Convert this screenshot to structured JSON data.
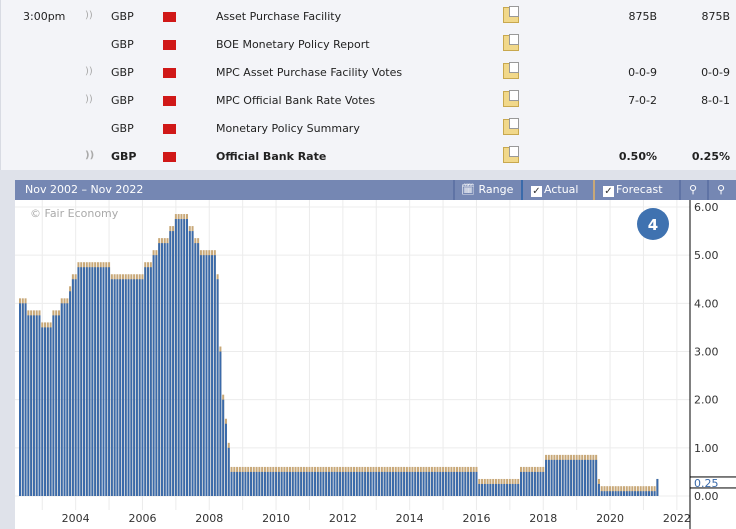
{
  "events": [
    {
      "time": "3:00pm",
      "sound": true,
      "currency": "GBP",
      "event": "Asset Purchase Facility",
      "actual": "875B",
      "forecast": "875B",
      "bold": false
    },
    {
      "time": "",
      "sound": false,
      "currency": "GBP",
      "event": "BOE Monetary Policy Report",
      "actual": "",
      "forecast": "",
      "bold": false
    },
    {
      "time": "",
      "sound": true,
      "currency": "GBP",
      "event": "MPC Asset Purchase Facility Votes",
      "actual": "0-0-9",
      "forecast": "0-0-9",
      "bold": false
    },
    {
      "time": "",
      "sound": true,
      "currency": "GBP",
      "event": "MPC Official Bank Rate Votes",
      "actual": "7-0-2",
      "forecast": "8-0-1",
      "bold": false
    },
    {
      "time": "",
      "sound": false,
      "currency": "GBP",
      "event": "Monetary Policy Summary",
      "actual": "",
      "forecast": "",
      "bold": false
    },
    {
      "time": "",
      "sound": true,
      "currency": "GBP",
      "event": "Official Bank Rate",
      "actual": "0.50%",
      "forecast": "0.25%",
      "bold": true
    }
  ],
  "chart_header": {
    "range_text": "Nov 2002 – Nov 2022",
    "range_button": "Range",
    "actual_label": "Actual",
    "forecast_label": "Forecast",
    "actual_checked": true,
    "forecast_checked": true
  },
  "watermark": "© Fair Economy",
  "badge": "4",
  "colors": {
    "actual": "#3a6aaa",
    "forecast": "#c8a878",
    "header": "#7587b3"
  },
  "chart_data": {
    "type": "bar",
    "x_range": [
      "2002-11",
      "2022-11"
    ],
    "ylim": [
      0,
      6
    ],
    "y_ticks": [
      "6.00",
      "5.00",
      "4.00",
      "3.00",
      "2.00",
      "1.00",
      "0.00"
    ],
    "x_ticks": [
      "2004",
      "2006",
      "2008",
      "2010",
      "2012",
      "2014",
      "2016",
      "2018",
      "2020",
      "2022"
    ],
    "highlight_label": "0.25",
    "grid": true,
    "actual_steps": [
      [
        "2002-11",
        4.0
      ],
      [
        "2003-02",
        3.75
      ],
      [
        "2003-07",
        3.5
      ],
      [
        "2003-11",
        3.75
      ],
      [
        "2004-02",
        4.0
      ],
      [
        "2004-05",
        4.25
      ],
      [
        "2004-06",
        4.5
      ],
      [
        "2004-08",
        4.75
      ],
      [
        "2005-08",
        4.5
      ],
      [
        "2006-08",
        4.75
      ],
      [
        "2006-11",
        5.0
      ],
      [
        "2007-01",
        5.25
      ],
      [
        "2007-05",
        5.5
      ],
      [
        "2007-07",
        5.75
      ],
      [
        "2007-12",
        5.5
      ],
      [
        "2008-02",
        5.25
      ],
      [
        "2008-04",
        5.0
      ],
      [
        "2008-10",
        4.5
      ],
      [
        "2008-11",
        3.0
      ],
      [
        "2008-12",
        2.0
      ],
      [
        "2009-01",
        1.5
      ],
      [
        "2009-02",
        1.0
      ],
      [
        "2009-03",
        0.5
      ],
      [
        "2016-08",
        0.25
      ],
      [
        "2017-11",
        0.5
      ],
      [
        "2018-08",
        0.75
      ],
      [
        "2020-03",
        0.25
      ],
      [
        "2020-04",
        0.1
      ],
      [
        "2021-12",
        0.25
      ]
    ],
    "last_bar": "2021-12"
  }
}
